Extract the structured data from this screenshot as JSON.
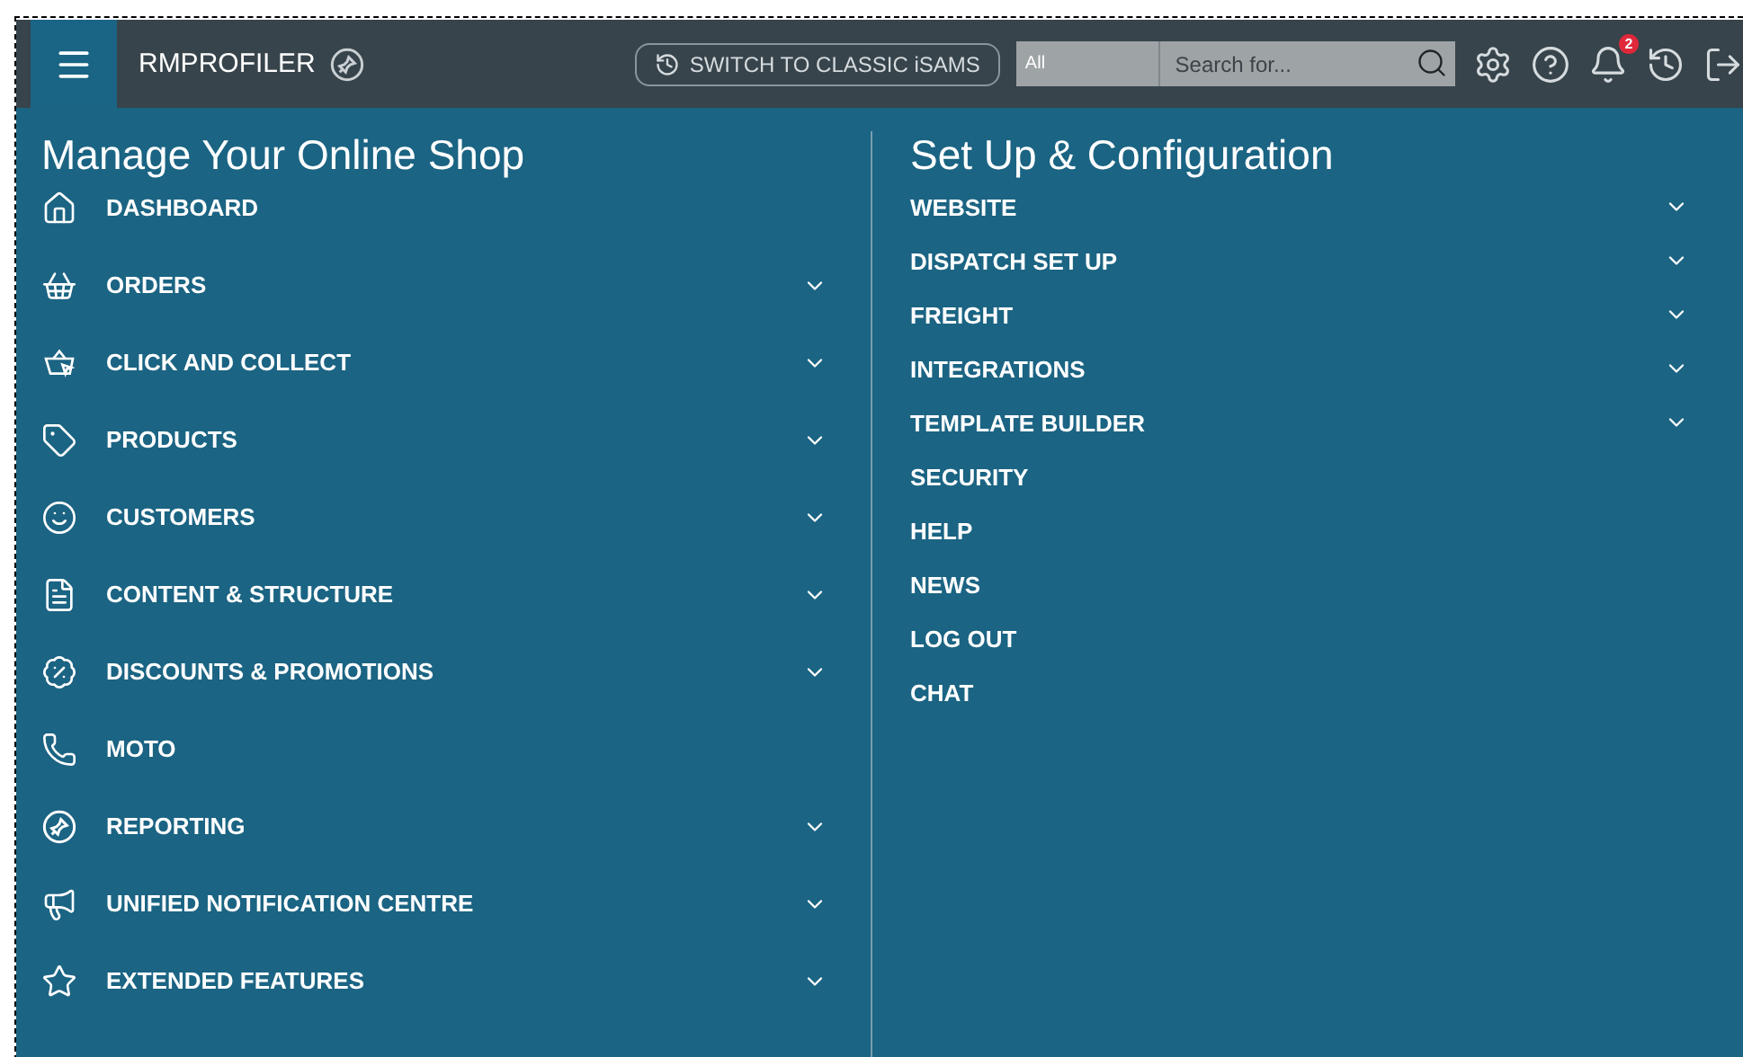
{
  "header": {
    "brand": "RMPROFILER",
    "switch_button": "SWITCH TO CLASSIC iSAMS",
    "search_scope": "All",
    "search": {
      "placeholder": "Search for..."
    },
    "notification_count": "2"
  },
  "left_section": {
    "title": "Manage Your Online Shop",
    "items": [
      {
        "label": "DASHBOARD",
        "kind": "home",
        "expandable": false
      },
      {
        "label": "ORDERS",
        "kind": "basket",
        "expandable": true
      },
      {
        "label": "CLICK AND COLLECT",
        "kind": "collect",
        "expandable": true
      },
      {
        "label": "PRODUCTS",
        "kind": "tag",
        "expandable": true
      },
      {
        "label": "CUSTOMERS",
        "kind": "face",
        "expandable": true
      },
      {
        "label": "CONTENT & STRUCTURE",
        "kind": "document",
        "expandable": true
      },
      {
        "label": "DISCOUNTS & PROMOTIONS",
        "kind": "discount",
        "expandable": true
      },
      {
        "label": "MOTO",
        "kind": "phone",
        "expandable": false
      },
      {
        "label": "REPORTING",
        "kind": "pin",
        "expandable": true
      },
      {
        "label": "UNIFIED NOTIFICATION CENTRE",
        "kind": "megaphone",
        "expandable": true
      },
      {
        "label": "EXTENDED FEATURES",
        "kind": "star",
        "expandable": true
      }
    ]
  },
  "right_section": {
    "title": "Set Up & Configuration",
    "items": [
      {
        "label": "WEBSITE",
        "expandable": true
      },
      {
        "label": "DISPATCH SET UP",
        "expandable": true
      },
      {
        "label": "FREIGHT",
        "expandable": true
      },
      {
        "label": "INTEGRATIONS",
        "expandable": true
      },
      {
        "label": "TEMPLATE BUILDER",
        "expandable": true
      },
      {
        "label": "SECURITY",
        "expandable": false
      },
      {
        "label": "HELP",
        "expandable": false
      },
      {
        "label": "NEWS",
        "expandable": false
      },
      {
        "label": "LOG OUT",
        "expandable": false
      },
      {
        "label": "CHAT",
        "expandable": false
      }
    ]
  }
}
